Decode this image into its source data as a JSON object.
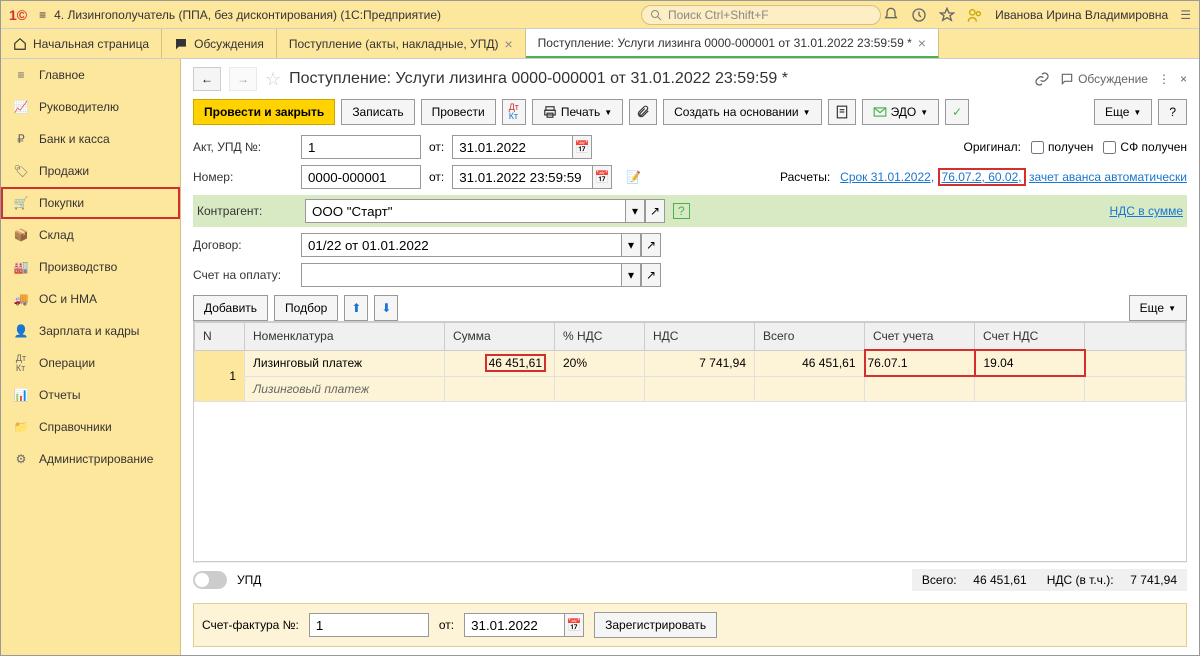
{
  "titlebar": {
    "app_title": "4. Лизингополучатель (ППА, без дисконтирования)  (1С:Предприятие)",
    "search_placeholder": "Поиск Ctrl+Shift+F",
    "user": "Иванова Ирина Владимировна"
  },
  "tabs": [
    {
      "label": "Начальная страница"
    },
    {
      "label": "Обсуждения"
    },
    {
      "label": "Поступление (акты, накладные, УПД)"
    },
    {
      "label": "Поступление: Услуги лизинга 0000-000001 от 31.01.2022 23:59:59 *"
    }
  ],
  "sidebar": [
    {
      "label": "Главное"
    },
    {
      "label": "Руководителю"
    },
    {
      "label": "Банк и касса"
    },
    {
      "label": "Продажи"
    },
    {
      "label": "Покупки"
    },
    {
      "label": "Склад"
    },
    {
      "label": "Производство"
    },
    {
      "label": "ОС и НМА"
    },
    {
      "label": "Зарплата и кадры"
    },
    {
      "label": "Операции"
    },
    {
      "label": "Отчеты"
    },
    {
      "label": "Справочники"
    },
    {
      "label": "Администрирование"
    }
  ],
  "doc": {
    "title": "Поступление: Услуги лизинга 0000-000001 от 31.01.2022 23:59:59 *",
    "discuss": "Обсуждение"
  },
  "toolbar": {
    "post_close": "Провести и закрыть",
    "save": "Записать",
    "post": "Провести",
    "print": "Печать",
    "create_based": "Создать на основании",
    "edo": "ЭДО",
    "more": "Еще",
    "help": "?"
  },
  "form": {
    "act_label": "Акт, УПД №:",
    "act_no": "1",
    "from": "от:",
    "act_date": "31.01.2022",
    "number_label": "Номер:",
    "number": "0000-000001",
    "number_date": "31.01.2022 23:59:59",
    "original_label": "Оригинал:",
    "received": "получен",
    "sf_received": "СФ получен",
    "calc_label": "Расчеты:",
    "calc_link1": "Срок 31.01.2022,",
    "calc_link2": "76.07.2, 60.02,",
    "calc_link3": "зачет аванса автоматически",
    "kontragent_label": "Контрагент:",
    "kontragent": "ООО \"Старт\"",
    "nds_link": "НДС в сумме",
    "dogovor_label": "Договор:",
    "dogovor": "01/22 от 01.01.2022",
    "schet_label": "Счет на оплату:",
    "schet": ""
  },
  "table_toolbar": {
    "add": "Добавить",
    "select": "Подбор",
    "more": "Еще"
  },
  "table": {
    "headers": [
      "N",
      "Номенклатура",
      "Сумма",
      "% НДС",
      "НДС",
      "Всего",
      "Счет учета",
      "Счет НДС"
    ],
    "row": {
      "n": "1",
      "nomen": "Лизинговый платеж",
      "sum": "46 451,61",
      "vat_pct": "20%",
      "vat": "7 741,94",
      "total": "46 451,61",
      "acc": "76.07.1",
      "vat_acc": "19.04",
      "nomen2": "Лизинговый платеж"
    }
  },
  "footer": {
    "upd": "УПД",
    "total_label": "Всего:",
    "total": "46 451,61",
    "nds_label": "НДС (в т.ч.):",
    "nds": "7 741,94"
  },
  "invoice": {
    "label": "Счет-фактура №:",
    "no": "1",
    "from": "от:",
    "date": "31.01.2022",
    "register": "Зарегистрировать"
  }
}
